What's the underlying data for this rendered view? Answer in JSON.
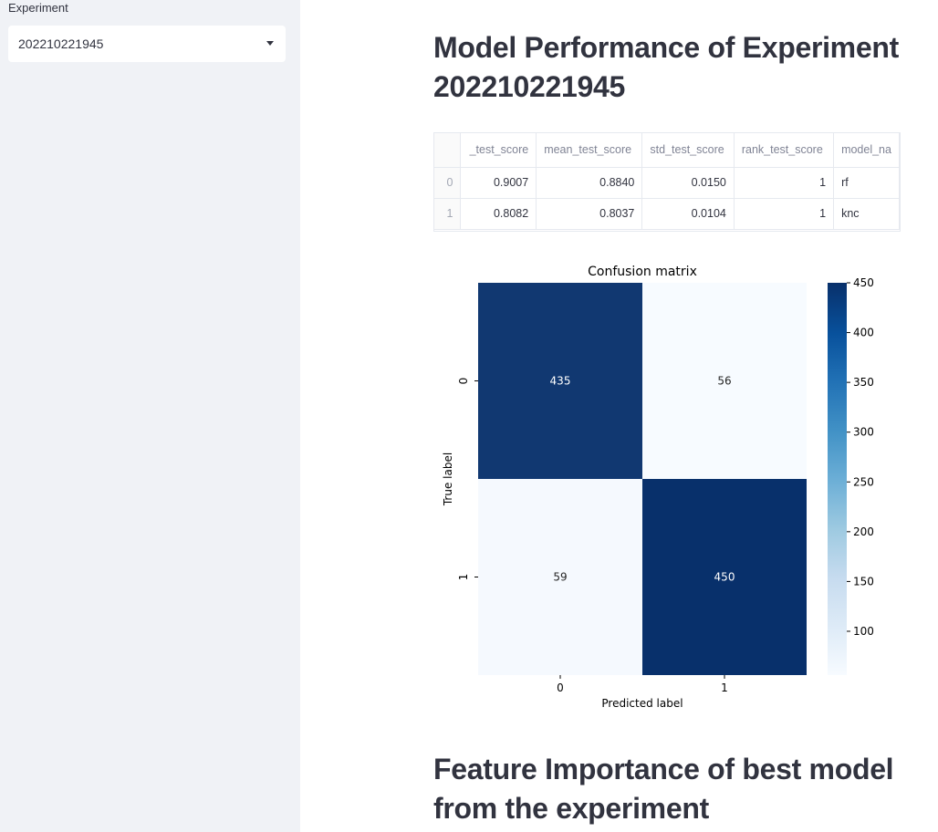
{
  "sidebar": {
    "label": "Experiment",
    "selected": "202210221945"
  },
  "main": {
    "title": "Model Performance of Experiment 202210221945",
    "section2_title": "Feature Importance of best model from the experiment",
    "table": {
      "columns": [
        "_test_score",
        "mean_test_score",
        "std_test_score",
        "rank_test_score",
        "model_na"
      ],
      "rows": [
        {
          "index": "0",
          "cells": [
            "0.9007",
            "0.8840",
            "0.0150",
            "1",
            "rf"
          ]
        },
        {
          "index": "1",
          "cells": [
            "0.8082",
            "0.8037",
            "0.0104",
            "1",
            "knc"
          ]
        }
      ]
    }
  },
  "chart_data": {
    "type": "heatmap",
    "title": "Confusion matrix",
    "xlabel": "Predicted label",
    "ylabel": "True label",
    "x_categories": [
      "0",
      "1"
    ],
    "y_categories": [
      "0",
      "1"
    ],
    "values": [
      [
        435,
        56
      ],
      [
        59,
        450
      ]
    ],
    "colorbar": {
      "colormap": "Blues",
      "range": [
        56,
        450
      ],
      "ticks": [
        100,
        150,
        200,
        250,
        300,
        350,
        400,
        450
      ]
    },
    "colors": {
      "dark": "#08306b",
      "light": "#f7fbff"
    }
  }
}
